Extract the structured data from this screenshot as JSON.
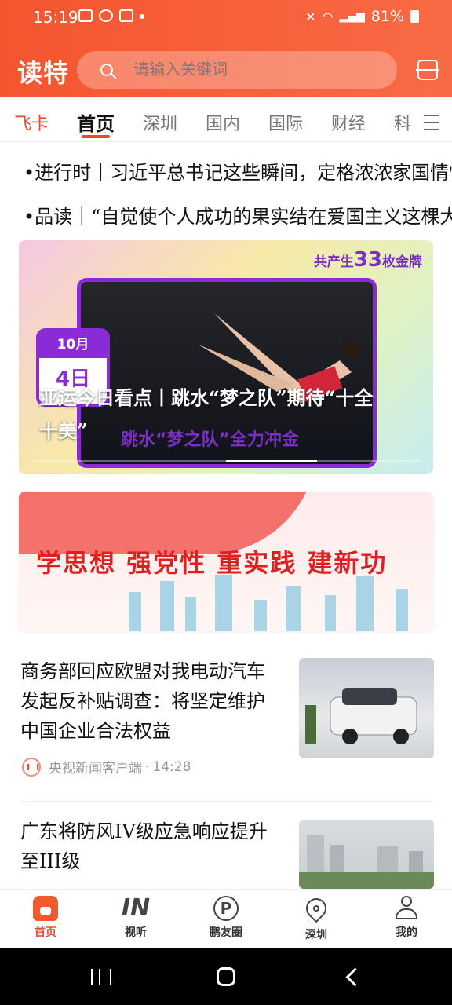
{
  "status": {
    "time": "15:19",
    "battery": "81%"
  },
  "header": {
    "logo": "读特",
    "search_placeholder": "请输入关键词"
  },
  "tabs": [
    "飞卡",
    "首页",
    "深圳",
    "国内",
    "国际",
    "财经",
    "科"
  ],
  "headlines": [
    "•进行时丨习近平总书记这些瞬间，定格浓浓家国情怀",
    "•品读｜“自觉使个人成功的果实结在爱国主义这棵大树上”"
  ],
  "hero": {
    "medal_banner_prefix": "共产生",
    "medal_count": "33",
    "medal_banner_suffix": "枚金牌",
    "calendar_month": "10月",
    "calendar_day": "4日",
    "image_caption": "跳水“梦之队”全力冲金",
    "title": "亚运今日看点丨跳水“梦之队”期待“十全十美”"
  },
  "banner": {
    "text": "学思想  强党性  重实践  建新功"
  },
  "news": [
    {
      "title": "商务部回应欧盟对我电动汽车发起反补贴调查：将坚定维护中国企业合法权益",
      "source": "央视新闻客户端",
      "time": "14:28"
    },
    {
      "title": "广东将防风IV级应急响应提升至III级"
    }
  ],
  "bottom_nav": [
    {
      "label": "首页",
      "icon": "home-icon"
    },
    {
      "label": "视听",
      "icon": "in-icon"
    },
    {
      "label": "鹏友圈",
      "icon": "p-circle-icon"
    },
    {
      "label": "深圳",
      "icon": "location-pin-icon"
    },
    {
      "label": "我的",
      "icon": "user-icon"
    }
  ],
  "colors": {
    "brand": "#f4552f",
    "accent": "#e84a2b",
    "purple": "#8a2bd6"
  }
}
